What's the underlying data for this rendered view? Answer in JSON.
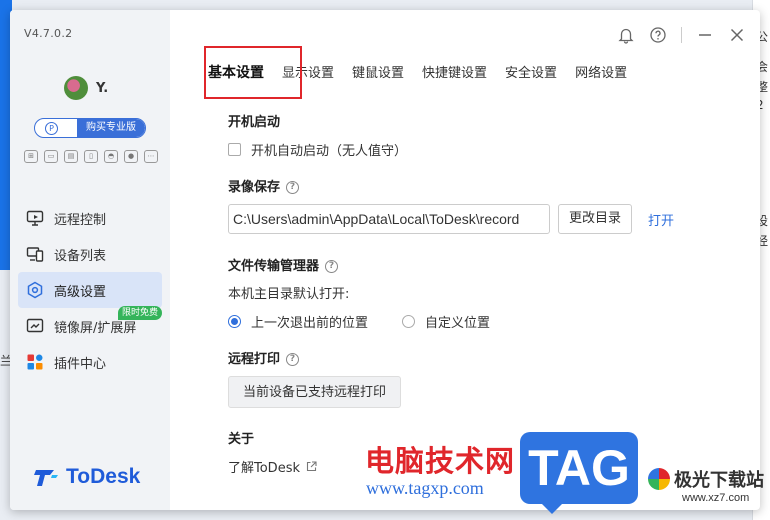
{
  "app": {
    "version": "V4.7.0.2",
    "user_name": "Y.",
    "pro_label": "购买专业版",
    "pro_icon_letter": "P",
    "logo_text": "ToDesk",
    "brand_color": "#1f5bd9",
    "accent_color": "#2f6fdc"
  },
  "sidebar": {
    "items": [
      {
        "label": "远程控制",
        "icon": "remote-control-icon"
      },
      {
        "label": "设备列表",
        "icon": "device-list-icon"
      },
      {
        "label": "高级设置",
        "icon": "advanced-settings-icon",
        "active": true
      },
      {
        "label": "镜像屏/扩展屏",
        "icon": "mirror-screen-icon",
        "badge": "限时免费"
      },
      {
        "label": "插件中心",
        "icon": "plugin-center-icon"
      }
    ]
  },
  "tabs": [
    {
      "label": "基本设置",
      "active": true
    },
    {
      "label": "显示设置"
    },
    {
      "label": "键鼠设置"
    },
    {
      "label": "快捷键设置"
    },
    {
      "label": "安全设置"
    },
    {
      "label": "网络设置"
    }
  ],
  "startup": {
    "title": "开机启动",
    "checkbox_label": "开机自动启动（无人值守）",
    "checked": false
  },
  "recording": {
    "title": "录像保存",
    "path": "C:\\Users\\admin\\AppData\\Local\\ToDesk\\record",
    "change_button": "更改目录",
    "open_link": "打开"
  },
  "file_transfer": {
    "title": "文件传输管理器",
    "sub_label": "本机主目录默认打开:",
    "options": [
      {
        "label": "上一次退出前的位置",
        "selected": true
      },
      {
        "label": "自定义位置",
        "selected": false
      }
    ]
  },
  "remote_print": {
    "title": "远程打印",
    "button": "当前设备已支持远程打印"
  },
  "about": {
    "title": "关于",
    "link": "了解ToDesk"
  },
  "watermark": {
    "cn_text": "电脑技术网",
    "url": "www.tagxp.com",
    "tag": "TAG",
    "site_name": "极光下载站",
    "site_url": "www.xz7.com"
  },
  "background_fragments": [
    "公",
    "会",
    "整",
    "2",
    "设",
    "经",
    "兰"
  ]
}
